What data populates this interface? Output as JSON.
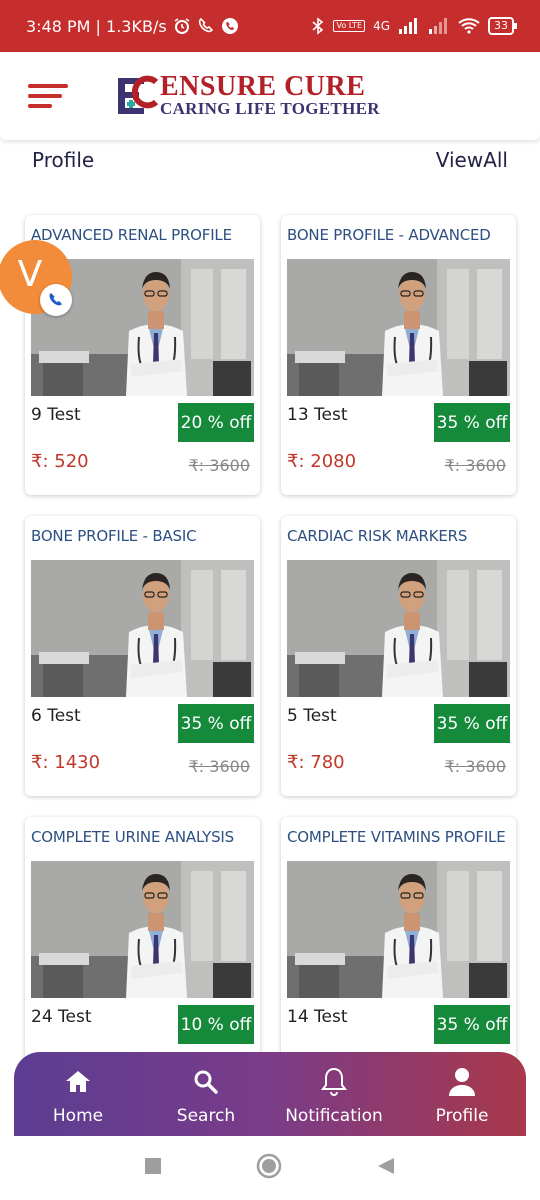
{
  "status_bar": {
    "time_speed": "3:48 PM | 1.3KB/s",
    "network": "4G",
    "volte": "Vo LTE",
    "battery": "33"
  },
  "header": {
    "brand_title": "ENSURE CURE",
    "brand_tagline": "CARING LIFE TOGETHER"
  },
  "section": {
    "title": "Profile",
    "view_all": "ViewAll"
  },
  "fab": {
    "letter": "V"
  },
  "cards": [
    {
      "title": "ADVANCED RENAL PROFILE",
      "tests": "9 Test",
      "discount": "20 % off",
      "price": "₹: 520",
      "mrp": "₹: 3600"
    },
    {
      "title": "BONE PROFILE - ADVANCED",
      "tests": "13 Test",
      "discount": "35 % off",
      "price": "₹: 2080",
      "mrp": "₹: 3600"
    },
    {
      "title": "BONE PROFILE - BASIC",
      "tests": "6 Test",
      "discount": "35 % off",
      "price": "₹: 1430",
      "mrp": "₹: 3600"
    },
    {
      "title": "CARDIAC RISK MARKERS",
      "tests": "5 Test",
      "discount": "35 % off",
      "price": "₹: 780",
      "mrp": "₹: 3600"
    },
    {
      "title": "COMPLETE URINE ANALYSIS",
      "tests": "24 Test",
      "discount": "10 % off",
      "price": "",
      "mrp": ""
    },
    {
      "title": "COMPLETE VITAMINS PROFILE",
      "tests": "14 Test",
      "discount": "35 % off",
      "price": "",
      "mrp": ""
    }
  ],
  "bottom_nav": [
    {
      "label": "Home",
      "icon": "home-icon"
    },
    {
      "label": "Search",
      "icon": "search-icon"
    },
    {
      "label": "Notification",
      "icon": "bell-icon"
    },
    {
      "label": "Profile",
      "icon": "user-icon"
    }
  ],
  "colors": {
    "brand_red": "#c62d2d",
    "discount_green": "#158a3b",
    "price_red": "#c0392b",
    "title_blue": "#2d4f82",
    "fab_orange": "#f28c3a"
  }
}
